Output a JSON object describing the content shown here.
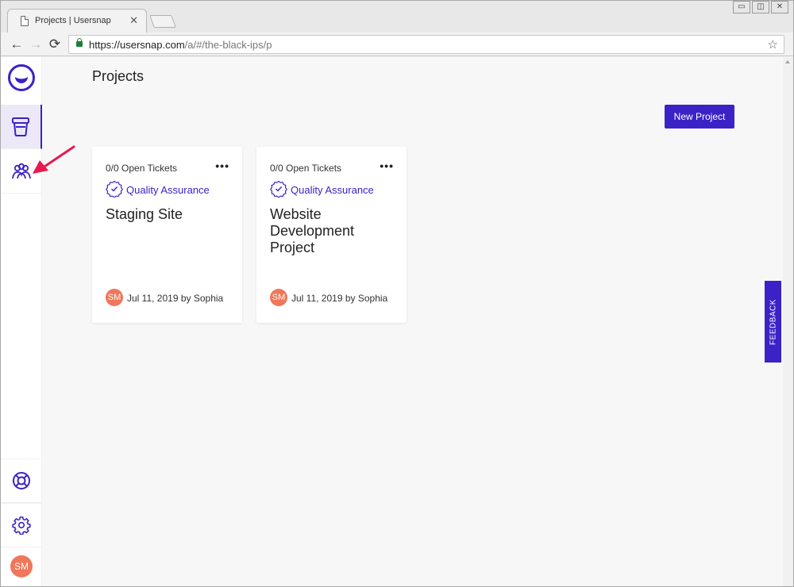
{
  "browser": {
    "tab_title": "Projects | Usersnap",
    "tab_close": "✕",
    "window_buttons": [
      "▭",
      "◫",
      "✕"
    ],
    "url_host": "https://usersnap.com",
    "url_path": "/a/#/the-black-ips/p",
    "back": "←",
    "forward": "→",
    "reload": "⟳",
    "star": "☆"
  },
  "sidebar": {
    "logo_icon": "usersnap-logo-icon",
    "items": [
      {
        "icon": "projects-icon",
        "active": true
      },
      {
        "icon": "people-icon",
        "active": false
      },
      {
        "icon": "help-icon",
        "active": false
      },
      {
        "icon": "settings-icon",
        "active": false
      }
    ],
    "user_initials": "SM"
  },
  "header": {
    "title": "Projects",
    "new_project_label": "New Project"
  },
  "projects": [
    {
      "tickets": "0/0 Open Tickets",
      "more": "•••",
      "type": "Quality Assurance",
      "name": "Staging Site",
      "author_initials": "SM",
      "meta": "Jul 11, 2019 by Sophia"
    },
    {
      "tickets": "0/0 Open Tickets",
      "more": "•••",
      "type": "Quality Assurance",
      "name": "Website Development Project",
      "author_initials": "SM",
      "meta": "Jul 11, 2019 by Sophia"
    }
  ],
  "feedback_label": "FEEDBACK",
  "colors": {
    "accent": "#3b22c7",
    "avatar": "#f0775a",
    "annotation_arrow": "#e8194f"
  }
}
